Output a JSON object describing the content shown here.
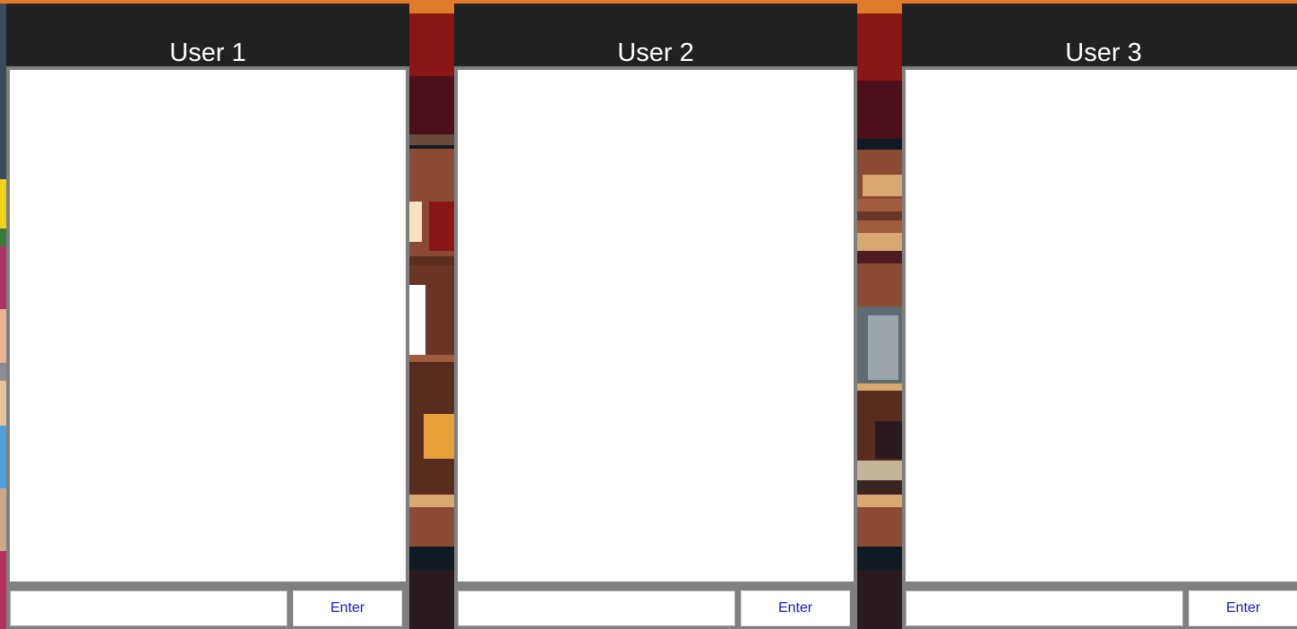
{
  "panels": [
    {
      "title": "User 1",
      "input_value": "",
      "input_placeholder": "",
      "enter_label": "Enter"
    },
    {
      "title": "User 2",
      "input_value": "",
      "input_placeholder": "",
      "enter_label": "Enter"
    },
    {
      "title": "User 3",
      "input_value": "",
      "input_placeholder": "",
      "enter_label": "Enter"
    }
  ],
  "colors": {
    "header_background": "#212121",
    "panel_border": "#7f7f7f",
    "chat_background": "#ffffff",
    "button_text": "#1515c8"
  }
}
